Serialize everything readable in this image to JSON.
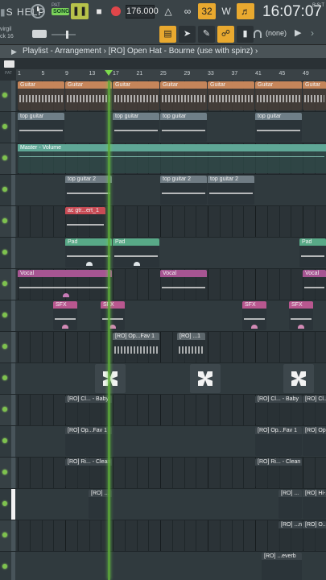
{
  "topbar": {
    "menu_text": "S HELP",
    "pattern_label": "PAT",
    "song_label": "SONG",
    "tempo": "176.000",
    "time": "16:07:07",
    "time_sub": "B:S:T",
    "hint_line1": "virgil",
    "hint_line2": "ck 16",
    "snap_value": "(none)"
  },
  "titlebar": {
    "text": "Playlist - Arrangement  ›  [RO] Open Hat - Bourne (use with spinz)  ›"
  },
  "ruler": {
    "pat_label": "PAT",
    "bars": [
      "1",
      "5",
      "9",
      "13",
      "17",
      "21",
      "25",
      "29",
      "33",
      "37",
      "41",
      "45",
      "49"
    ]
  },
  "clips": {
    "guitar": "Guitar",
    "top_guitar": "top guitar",
    "master_volume": "Master - Volume",
    "top_guitar_2": "top guitar 2",
    "ac_gtr": "ac gtr...ert_1",
    "pad": "Pad",
    "vocal": "Vocal",
    "sfx": "SFX",
    "open_hat_1": "[RO] Op...Fav 1",
    "open_hat_2": "[RO] ...1",
    "clap_1": "[RO] Cl... - Baby",
    "open_fav": "[RO] Op...Fav 1",
    "rim_clean": "[RO] Ri... - Clean",
    "ro_short": "[RO] ...",
    "ro_hi": "[RO] Hi-...",
    "ro_nz": "[RO] ...nz",
    "ro_o": "[RO] O...",
    "ro_reverb": "[RO] ...everb"
  }
}
